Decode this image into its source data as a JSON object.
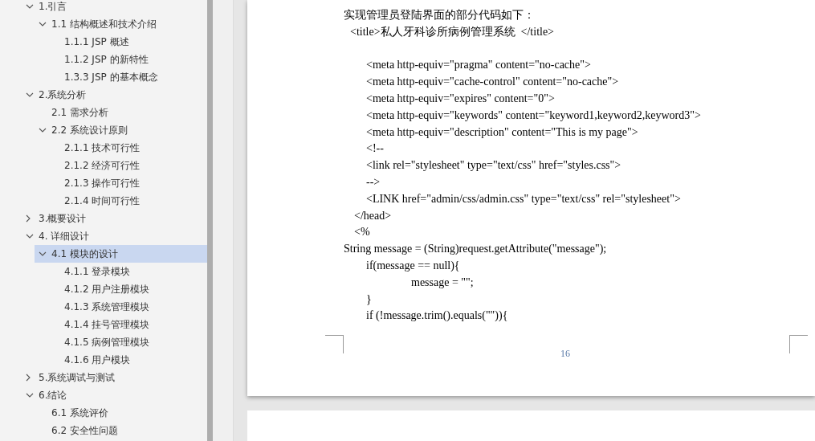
{
  "nav": {
    "items": [
      {
        "label": "1.引言",
        "expanded": true,
        "selected": false,
        "children": [
          {
            "label": "1.1 结构概述和技术介绍",
            "expanded": true,
            "selected": false,
            "children": [
              {
                "label": "1.1.1 JSP 概述",
                "selected": false
              },
              {
                "label": "1.1.2 JSP 的新特性",
                "selected": false
              },
              {
                "label": "1.3.3 JSP 的基本概念",
                "selected": false
              }
            ]
          }
        ]
      },
      {
        "label": "2.系统分析",
        "expanded": true,
        "selected": false,
        "children": [
          {
            "label": "2.1  需求分析",
            "selected": false
          },
          {
            "label": "2.2  系统设计原则",
            "expanded": true,
            "selected": false,
            "children": [
              {
                "label": "2.1.1 技术可行性",
                "selected": false
              },
              {
                "label": "2.1.2  经济可行性",
                "selected": false
              },
              {
                "label": "2.1.3  操作可行性",
                "selected": false
              },
              {
                "label": "2.1.4  时间可行性",
                "selected": false
              }
            ]
          }
        ]
      },
      {
        "label": "3.概要设计",
        "expanded": false,
        "selected": false
      },
      {
        "label": "4. 详细设计",
        "expanded": true,
        "selected": false,
        "children": [
          {
            "label": "4.1  模块的设计",
            "expanded": true,
            "selected": true,
            "children": [
              {
                "label": "4.1.1  登录模块",
                "selected": false
              },
              {
                "label": "4.1.2  用户注册模块",
                "selected": false
              },
              {
                "label": "4.1.3  系统管理模块",
                "selected": false
              },
              {
                "label": "4.1.4  挂号管理模块",
                "selected": false
              },
              {
                "label": "4.1.5 病例管理模块",
                "selected": false
              },
              {
                "label": "4.1.6 用户模块",
                "selected": false
              }
            ]
          }
        ]
      },
      {
        "label": "5.系统调试与测试",
        "expanded": false,
        "selected": false
      },
      {
        "label": "6.结论",
        "expanded": true,
        "selected": false,
        "children": [
          {
            "label": "6.1  系统评价",
            "selected": false
          },
          {
            "label": "6.2  安全性问题",
            "selected": false
          }
        ]
      }
    ]
  },
  "document": {
    "lines": [
      {
        "kind": "body",
        "text": "实现管理员登陆界面的部分代码如下："
      },
      {
        "kind": "title",
        "text": "<title>私人牙科诊所病例管理系统  </title>"
      },
      {
        "kind": "tag",
        "text": "<meta http-equiv=\"pragma\" content=\"no-cache\">"
      },
      {
        "kind": "tag",
        "text": "<meta http-equiv=\"cache-control\" content=\"no-cache\">"
      },
      {
        "kind": "tag",
        "text": "<meta http-equiv=\"expires\" content=\"0\">"
      },
      {
        "kind": "tag",
        "text": "<meta http-equiv=\"keywords\" content=\"keyword1,keyword2,keyword3\">"
      },
      {
        "kind": "tag",
        "text": "<meta http-equiv=\"description\" content=\"This is my page\">"
      },
      {
        "kind": "tag",
        "text": "<!--"
      },
      {
        "kind": "tag",
        "text": "<link rel=\"stylesheet\" type=\"text/css\" href=\"styles.css\">"
      },
      {
        "kind": "tag",
        "text": "-->"
      },
      {
        "kind": "tag",
        "text": "<LINK href=\"admin/css/admin.css\" type=\"text/css\" rel=\"stylesheet\">"
      },
      {
        "kind": "head",
        "text": "</head>"
      },
      {
        "kind": "head",
        "text": "<%"
      },
      {
        "kind": "body",
        "text": "String message = (String)request.getAttribute(\"message\");"
      },
      {
        "kind": "tag",
        "text": "if(message == null){"
      },
      {
        "kind": "deep",
        "text": "message = \"\";"
      },
      {
        "kind": "tag",
        "text": "}"
      },
      {
        "kind": "tag",
        "text": "if (!message.trim().equals(\"\")){"
      }
    ],
    "page_number": "16"
  }
}
